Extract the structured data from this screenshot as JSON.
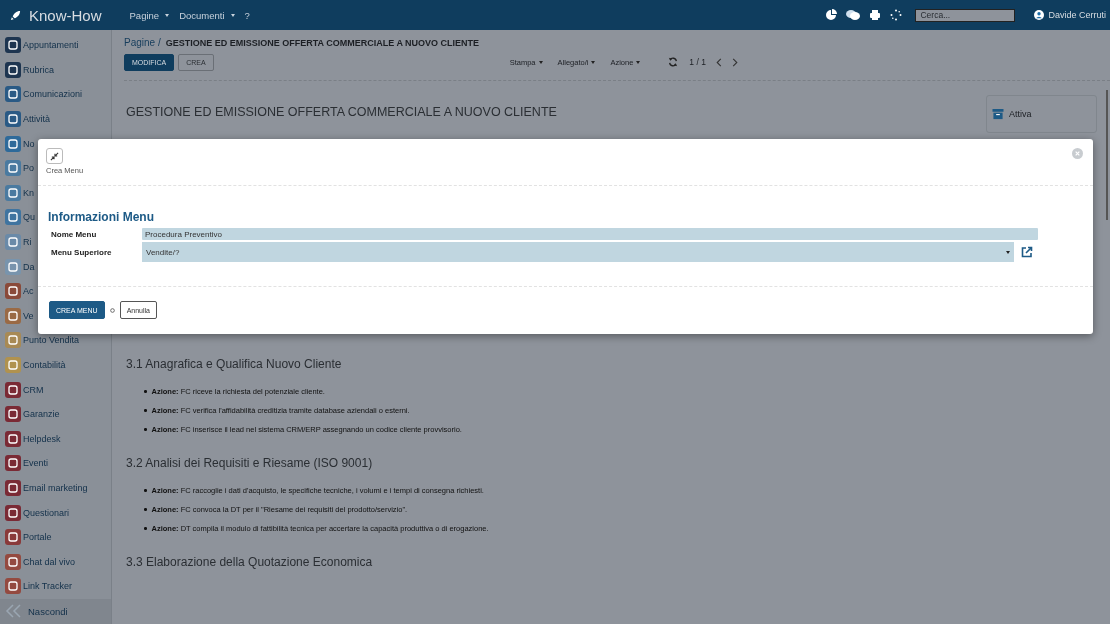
{
  "topbar": {
    "app_name": "Know-How",
    "menus": [
      {
        "label": "Pagine",
        "dropdown": true
      },
      {
        "label": "Documenti",
        "dropdown": true
      },
      {
        "label": "?",
        "dropdown": false
      }
    ],
    "search": {
      "placeholder": "Cerca..."
    },
    "user": "Davide Cerruti"
  },
  "sidebar": {
    "items": [
      {
        "label": "Appuntamenti",
        "color": "#1e3550"
      },
      {
        "label": "Rubrica",
        "color": "#1e3550"
      },
      {
        "label": "Comunicazioni",
        "color": "#2a5a85"
      },
      {
        "label": "Attività",
        "color": "#2a5a85"
      },
      {
        "label": "No",
        "color": "#2e6a9a"
      },
      {
        "label": "Po",
        "color": "#4a7aa0"
      },
      {
        "label": "Kn",
        "color": "#4a7aa0"
      },
      {
        "label": "Qu",
        "color": "#3f74a0"
      },
      {
        "label": "Ri",
        "color": "#6a8aa8"
      },
      {
        "label": "Da",
        "color": "#7894ad"
      },
      {
        "label": "Ac",
        "color": "#8a4a3a"
      },
      {
        "label": "Ve",
        "color": "#9a6a45"
      },
      {
        "label": "Punto Vendita",
        "color": "#a88a55"
      },
      {
        "label": "Contabilità",
        "color": "#b0924f"
      },
      {
        "label": "CRM",
        "color": "#7a2a35"
      },
      {
        "label": "Garanzie",
        "color": "#7a2a35"
      },
      {
        "label": "Helpdesk",
        "color": "#7a2a35"
      },
      {
        "label": "Eventi",
        "color": "#7a2a35"
      },
      {
        "label": "Email marketing",
        "color": "#7a2a35"
      },
      {
        "label": "Questionari",
        "color": "#7a2a35"
      },
      {
        "label": "Portale",
        "color": "#8a3a3a"
      },
      {
        "label": "Chat dal vivo",
        "color": "#944a40"
      },
      {
        "label": "Link Tracker",
        "color": "#944a40"
      }
    ],
    "collapse_label": "Nascondi"
  },
  "page": {
    "breadcrumb": "Pagine /",
    "title": "GESTIONE ED EMISSIONE OFFERTA COMMERCIALE A NUOVO CLIENTE",
    "buttons": [
      {
        "label": "MODIFICA",
        "kind": "primary"
      },
      {
        "label": "CREA",
        "kind": "secondary"
      }
    ],
    "toolbar": [
      "Stampa",
      "Allegato/i",
      "Azione"
    ],
    "pager": "1 / 1",
    "document": {
      "title": "GESTIONE ED EMISSIONE OFFERTA COMMERCIALE A NUOVO CLIENTE",
      "status": "Attiva",
      "sections": [
        {
          "heading": "3.1 Anagrafica e Qualifica Nuovo Cliente",
          "bullets": [
            "**Azione:** FC riceve la richiesta del potenziale cliente.",
            "**Azione:** FC verifica l'affidabilità creditizia tramite database aziendali o esterni.",
            "**Azione:** FC inserisce il lead nel sistema CRM/ERP assegnando un codice cliente provvisorio."
          ]
        },
        {
          "heading": "3.2 Analisi dei Requisiti e Riesame (ISO 9001)",
          "bullets": [
            "**Azione:** FC raccoglie i dati d'acquisto, le specifiche tecniche, i volumi e i tempi di consegna richiesti.",
            "**Azione:** FC convoca la DT per il \"Riesame dei requisiti del prodotto/servizio\".",
            "**Azione:** DT compila il modulo di fattibilità tecnica per accertare la capacità produttiva o di erogazione."
          ]
        },
        {
          "heading": "3.3 Elaborazione della Quotazione Economica"
        }
      ]
    }
  },
  "modal": {
    "header_label": "Crea Menu",
    "section_title": "Informazioni Menu",
    "fields": [
      {
        "label": "Nome Menu",
        "value": "Procedura Preventivo",
        "kind": "text"
      },
      {
        "label": "Menu Superiore",
        "value": "Vendite/?",
        "kind": "select"
      }
    ],
    "buttons": [
      {
        "label": "CREA MENU",
        "kind": "primary"
      },
      {
        "label": "Annulla",
        "kind": "secondary"
      }
    ]
  }
}
